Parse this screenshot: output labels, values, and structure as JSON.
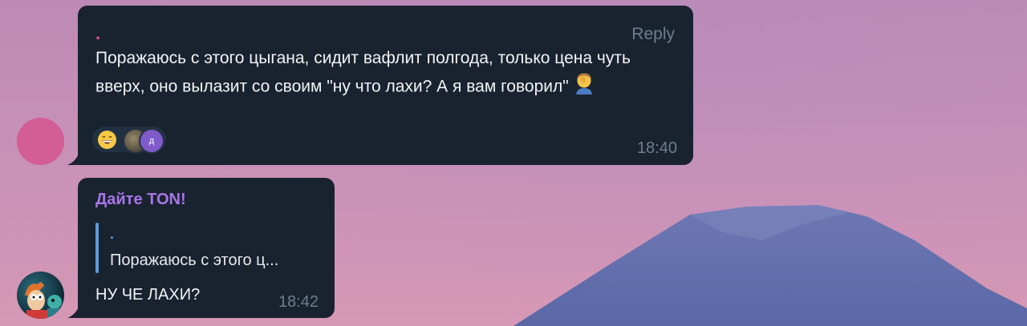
{
  "messages": [
    {
      "sender": ".",
      "reply_label": "Reply",
      "text": "Поражаюсь с этого цыгана, сидит вафлит полгода, только цена чуть вверх, оно вылазит со своим \"ну что лахи? А я вам говорил\"",
      "inline_emoji": "facepalm-emoji",
      "reactions": {
        "emoji": "grinning-emoji",
        "second_avatar_label": "д"
      },
      "time": "18:40"
    },
    {
      "sender": "Дайте TON!",
      "quote": {
        "sender": ".",
        "text": "Поражаюсь с этого ц..."
      },
      "text": "НУ ЧЕ ЛАХИ?",
      "time": "18:42"
    }
  ],
  "colors": {
    "bubble": "#19232f",
    "sender1": "#e2518d",
    "sender2": "#a775e6",
    "quote_accent": "#5e9bd6",
    "meta": "#6e7e8e"
  }
}
